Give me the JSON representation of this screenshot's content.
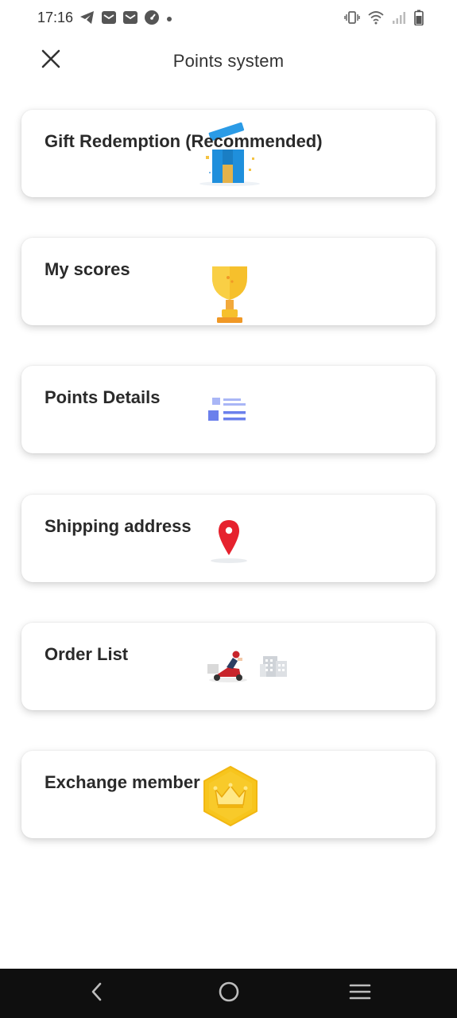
{
  "status_bar": {
    "time": "17:16",
    "left_icons": [
      "telegram-icon",
      "mail-icon",
      "mail-icon",
      "speedometer-icon",
      "dot-icon"
    ],
    "right_icons": [
      "vibrate-icon",
      "wifi-icon",
      "signal-icon",
      "battery-icon"
    ]
  },
  "header": {
    "title": "Points system",
    "close_icon": "close-icon"
  },
  "menu": {
    "items": [
      {
        "label": "Gift Redemption (Recommended)",
        "icon": "gift-box-icon"
      },
      {
        "label": "My scores",
        "icon": "trophy-icon"
      },
      {
        "label": "Points Details",
        "icon": "list-details-icon"
      },
      {
        "label": "Shipping address",
        "icon": "location-pin-icon"
      },
      {
        "label": "Order List",
        "icon": "delivery-icon"
      },
      {
        "label": "Exchange member",
        "icon": "crown-icon"
      }
    ]
  },
  "nav_bar": {
    "buttons": [
      "back-icon",
      "home-icon",
      "recents-icon"
    ]
  },
  "colors": {
    "background": "#ffffff",
    "card_shadow": "#d0d0d0",
    "nav_bar": "#0f0f0f",
    "gift_blue": "#1f8fdc",
    "trophy_gold": "#f6c02c",
    "details_blue": "#7b8ff0",
    "pin_red": "#e6222e",
    "crown_gold": "#f7c51d"
  }
}
